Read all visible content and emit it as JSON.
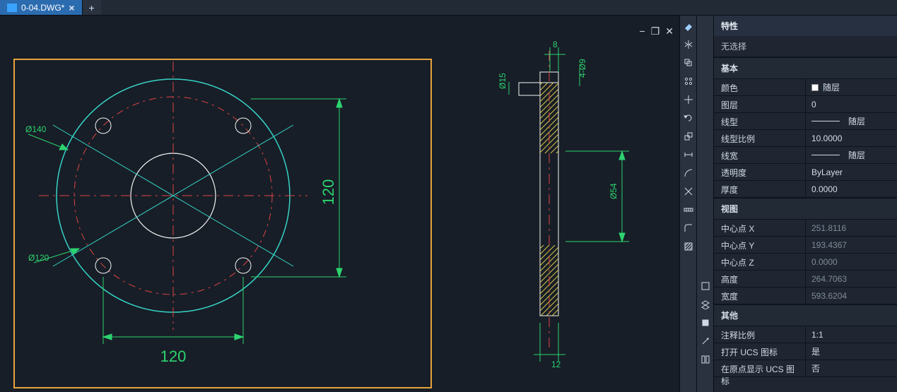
{
  "tabs": {
    "active_file": "0-04.DWG*"
  },
  "toolbars": {
    "right1": [
      "eraser",
      "mirror",
      "offset",
      "array",
      "move",
      "rotate",
      "scale",
      "stretch",
      "arc",
      "trim",
      "measure",
      "fillet",
      "hatch"
    ],
    "right2": [
      "style",
      "layers",
      "block",
      "match",
      "properties"
    ]
  },
  "properties": {
    "title": "特性",
    "no_selection": "无选择",
    "sections": {
      "basic": {
        "title": "基本",
        "rows": [
          {
            "label": "颜色",
            "value": "随层",
            "swatch": true
          },
          {
            "label": "图层",
            "value": "0"
          },
          {
            "label": "线型",
            "value": "随层",
            "lineprefix": true
          },
          {
            "label": "线型比例",
            "value": "10.0000"
          },
          {
            "label": "线宽",
            "value": "随层",
            "lineprefix": true
          },
          {
            "label": "透明度",
            "value": "ByLayer"
          },
          {
            "label": "厚度",
            "value": "0.0000"
          }
        ]
      },
      "view": {
        "title": "视图",
        "rows": [
          {
            "label": "中心点 X",
            "value": "251.8116",
            "dim": true
          },
          {
            "label": "中心点 Y",
            "value": "193.4367",
            "dim": true
          },
          {
            "label": "中心点 Z",
            "value": "0.0000",
            "dim": true
          },
          {
            "label": "高度",
            "value": "264.7063",
            "dim": true
          },
          {
            "label": "宽度",
            "value": "593.6204",
            "dim": true
          }
        ]
      },
      "other": {
        "title": "其他",
        "rows": [
          {
            "label": "注释比例",
            "value": "1:1"
          },
          {
            "label": "打开 UCS 图标",
            "value": "是"
          },
          {
            "label": "在原点显示 UCS 图标",
            "value": "否"
          }
        ]
      }
    }
  },
  "drawing": {
    "frame_color": "#e6a23c",
    "dims": {
      "front_h": "120",
      "front_v": "120",
      "d140": "Ø140",
      "d120": "Ø120",
      "side_top": "8",
      "side_left": "Ø15",
      "side_th_top": "4-Ø9",
      "side_th_right": "Ø54",
      "side_bottom": "12"
    }
  },
  "winctrls": {
    "min": "−",
    "max": "❐",
    "close": "✕"
  }
}
